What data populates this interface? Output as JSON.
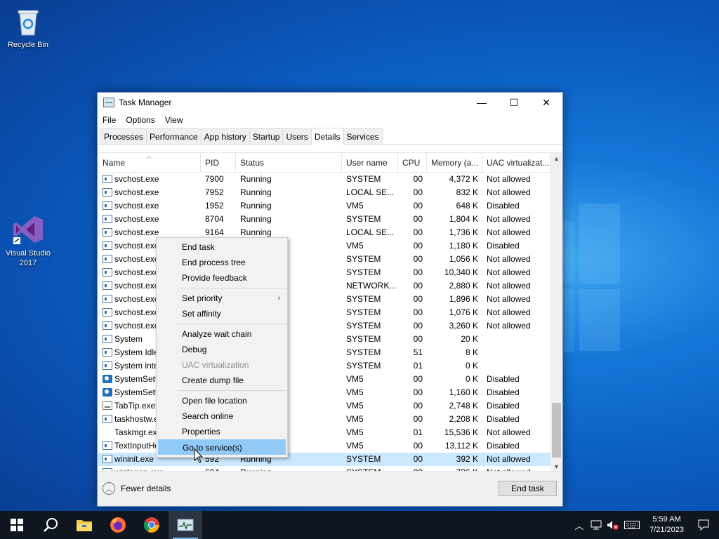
{
  "desktop": {
    "icons": [
      {
        "label": "Recycle Bin"
      },
      {
        "label": "Visual Studio 2017"
      }
    ]
  },
  "window": {
    "title": "Task Manager",
    "controls": {
      "minimize": "—",
      "maximize": "☐",
      "close": "✕"
    },
    "menu": [
      "File",
      "Options",
      "View"
    ],
    "tabs": [
      "Processes",
      "Performance",
      "App history",
      "Startup",
      "Users",
      "Details",
      "Services"
    ],
    "active_tab": "Details",
    "columns": [
      "Name",
      "PID",
      "Status",
      "User name",
      "CPU",
      "Memory (a...",
      "UAC virtualizat..."
    ],
    "rows": [
      {
        "name": "svchost.exe",
        "pid": "7900",
        "status": "Running",
        "user": "SYSTEM",
        "cpu": "00",
        "mem": "4,372 K",
        "uac": "Not allowed",
        "icon": "service"
      },
      {
        "name": "svchost.exe",
        "pid": "7952",
        "status": "Running",
        "user": "LOCAL SE...",
        "cpu": "00",
        "mem": "832 K",
        "uac": "Not allowed",
        "icon": "service"
      },
      {
        "name": "svchost.exe",
        "pid": "1952",
        "status": "Running",
        "user": "VM5",
        "cpu": "00",
        "mem": "648 K",
        "uac": "Disabled",
        "icon": "service"
      },
      {
        "name": "svchost.exe",
        "pid": "8704",
        "status": "Running",
        "user": "SYSTEM",
        "cpu": "00",
        "mem": "1,804 K",
        "uac": "Not allowed",
        "icon": "service"
      },
      {
        "name": "svchost.exe",
        "pid": "9164",
        "status": "Running",
        "user": "LOCAL SE...",
        "cpu": "00",
        "mem": "1,736 K",
        "uac": "Not allowed",
        "icon": "service"
      },
      {
        "name": "svchost.exe",
        "pid": "",
        "status": "",
        "user": "VM5",
        "cpu": "00",
        "mem": "1,180 K",
        "uac": "Disabled",
        "icon": "service"
      },
      {
        "name": "svchost.exe",
        "pid": "",
        "status": "",
        "user": "SYSTEM",
        "cpu": "00",
        "mem": "1,056 K",
        "uac": "Not allowed",
        "icon": "service"
      },
      {
        "name": "svchost.exe",
        "pid": "",
        "status": "",
        "user": "SYSTEM",
        "cpu": "00",
        "mem": "10,340 K",
        "uac": "Not allowed",
        "icon": "service"
      },
      {
        "name": "svchost.exe",
        "pid": "",
        "status": "",
        "user": "NETWORK...",
        "cpu": "00",
        "mem": "2,880 K",
        "uac": "Not allowed",
        "icon": "service"
      },
      {
        "name": "svchost.exe",
        "pid": "",
        "status": "",
        "user": "SYSTEM",
        "cpu": "00",
        "mem": "1,896 K",
        "uac": "Not allowed",
        "icon": "service"
      },
      {
        "name": "svchost.exe",
        "pid": "",
        "status": "",
        "user": "SYSTEM",
        "cpu": "00",
        "mem": "1,076 K",
        "uac": "Not allowed",
        "icon": "service"
      },
      {
        "name": "svchost.exe",
        "pid": "",
        "status": "",
        "user": "SYSTEM",
        "cpu": "00",
        "mem": "3,260 K",
        "uac": "Not allowed",
        "icon": "service"
      },
      {
        "name": "System",
        "pid": "",
        "status": "",
        "user": "SYSTEM",
        "cpu": "00",
        "mem": "20 K",
        "uac": "",
        "icon": "service"
      },
      {
        "name": "System Idle",
        "pid": "",
        "status": "",
        "user": "SYSTEM",
        "cpu": "51",
        "mem": "8 K",
        "uac": "",
        "icon": "service"
      },
      {
        "name": "System inte",
        "pid": "",
        "status": "",
        "user": "SYSTEM",
        "cpu": "01",
        "mem": "0 K",
        "uac": "",
        "icon": "service"
      },
      {
        "name": "SystemSetti",
        "pid": "",
        "status": "",
        "user": "VM5",
        "cpu": "00",
        "mem": "0 K",
        "uac": "Disabled",
        "icon": "gear"
      },
      {
        "name": "SystemSetti",
        "pid": "",
        "status": "",
        "user": "VM5",
        "cpu": "00",
        "mem": "1,160 K",
        "uac": "Disabled",
        "icon": "gear"
      },
      {
        "name": "TabTip.exe",
        "pid": "",
        "status": "",
        "user": "VM5",
        "cpu": "00",
        "mem": "2,748 K",
        "uac": "Disabled",
        "icon": "keyboard"
      },
      {
        "name": "taskhostw.e",
        "pid": "",
        "status": "",
        "user": "VM5",
        "cpu": "00",
        "mem": "2,208 K",
        "uac": "Disabled",
        "icon": "service"
      },
      {
        "name": "Taskmgr.exe",
        "pid": "",
        "status": "",
        "user": "VM5",
        "cpu": "01",
        "mem": "15,536 K",
        "uac": "Not allowed",
        "icon": "taskmgr"
      },
      {
        "name": "TextInputHo",
        "pid": "",
        "status": "",
        "user": "VM5",
        "cpu": "00",
        "mem": "13,112 K",
        "uac": "Disabled",
        "icon": "service"
      },
      {
        "name": "wininit.exe",
        "pid": "592",
        "status": "Running",
        "user": "SYSTEM",
        "cpu": "00",
        "mem": "392 K",
        "uac": "Not allowed",
        "icon": "service",
        "selected": true
      },
      {
        "name": "winlogon.exe",
        "pid": "604",
        "status": "Running",
        "user": "SYSTEM",
        "cpu": "00",
        "mem": "736 K",
        "uac": "Not allowed",
        "icon": "service"
      }
    ],
    "footer": {
      "fewer_details": "Fewer details",
      "end_task": "End task"
    }
  },
  "context_menu": {
    "items": [
      {
        "label": "End task"
      },
      {
        "label": "End process tree"
      },
      {
        "label": "Provide feedback"
      },
      {
        "sep": true
      },
      {
        "label": "Set priority",
        "submenu": true
      },
      {
        "label": "Set affinity"
      },
      {
        "sep": true
      },
      {
        "label": "Analyze wait chain"
      },
      {
        "label": "Debug"
      },
      {
        "label": "UAC virtualization",
        "disabled": true
      },
      {
        "label": "Create dump file"
      },
      {
        "sep": true
      },
      {
        "label": "Open file location"
      },
      {
        "label": "Search online"
      },
      {
        "label": "Properties"
      },
      {
        "label": "Go to service(s)",
        "highlighted": true
      }
    ]
  },
  "taskbar": {
    "clock_time": "5:59 AM",
    "clock_date": "7/21/2023",
    "apps": [
      "start",
      "search",
      "file-explorer",
      "firefox",
      "chrome",
      "task-manager"
    ],
    "active_app": "task-manager"
  }
}
